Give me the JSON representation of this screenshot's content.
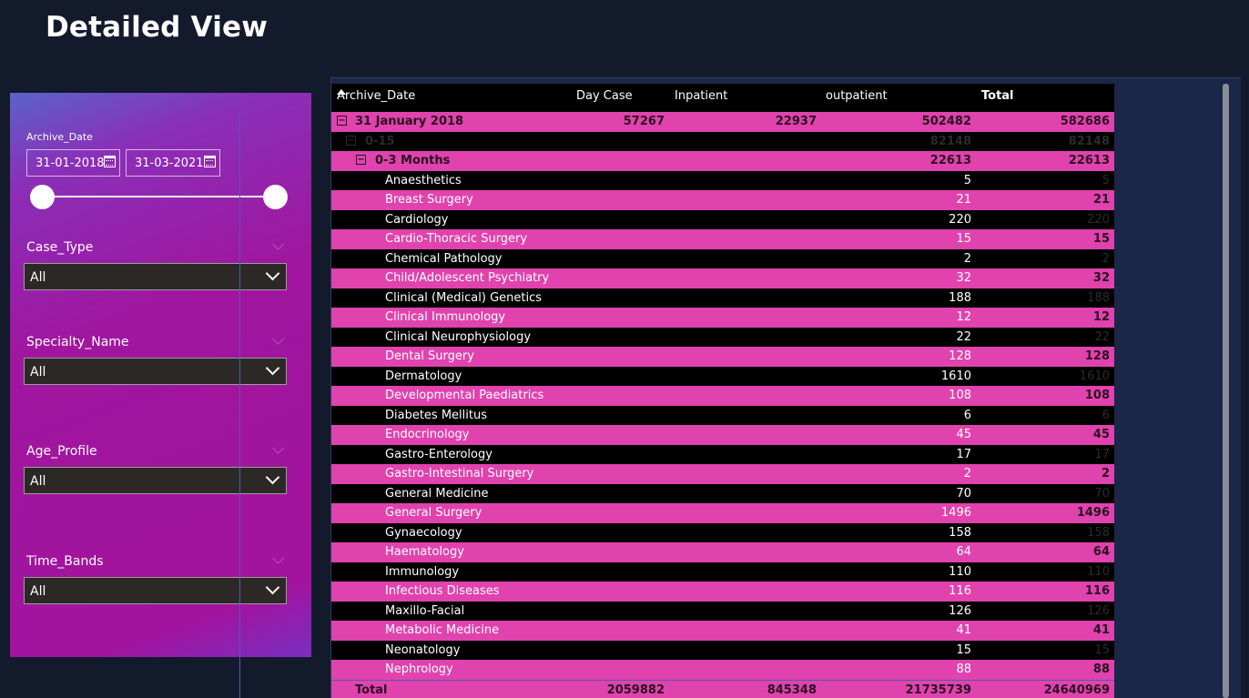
{
  "page": {
    "title": "Detailed View"
  },
  "filters": {
    "archive_date": {
      "label": "Archive_Date",
      "start": "31-01-2018",
      "end": "31-03-2021"
    },
    "case_type": {
      "label": "Case_Type",
      "value": "All"
    },
    "specialty_name": {
      "label": "Specialty_Name",
      "value": "All"
    },
    "age_profile": {
      "label": "Age_Profile",
      "value": "All"
    },
    "time_bands": {
      "label": "Time_Bands",
      "value": "All"
    }
  },
  "matrix": {
    "headers": {
      "row": "Archive_Date",
      "day_case": "Day Case",
      "inpatient": "Inpatient",
      "outpatient": "outpatient",
      "total": "Total"
    },
    "date_row": {
      "label": "31 January 2018",
      "day_case": "57267",
      "inpatient": "22937",
      "outpatient": "502482",
      "total": "582686"
    },
    "age_row": {
      "label": "0-15",
      "outpatient": "82148",
      "total": "82148"
    },
    "band_row": {
      "label": "0-3 Months",
      "outpatient": "22613",
      "total": "22613"
    },
    "rows": [
      {
        "name": "Anaesthetics",
        "outpatient": "5",
        "total": "5"
      },
      {
        "name": "Breast Surgery",
        "outpatient": "21",
        "total": "21"
      },
      {
        "name": "Cardiology",
        "outpatient": "220",
        "total": "220"
      },
      {
        "name": "Cardio-Thoracic Surgery",
        "outpatient": "15",
        "total": "15"
      },
      {
        "name": "Chemical Pathology",
        "outpatient": "2",
        "total": "2"
      },
      {
        "name": "Child/Adolescent Psychiatry",
        "outpatient": "32",
        "total": "32"
      },
      {
        "name": "Clinical (Medical) Genetics",
        "outpatient": "188",
        "total": "188"
      },
      {
        "name": "Clinical Immunology",
        "outpatient": "12",
        "total": "12"
      },
      {
        "name": "Clinical Neurophysiology",
        "outpatient": "22",
        "total": "22"
      },
      {
        "name": "Dental Surgery",
        "outpatient": "128",
        "total": "128"
      },
      {
        "name": "Dermatology",
        "outpatient": "1610",
        "total": "1610"
      },
      {
        "name": "Developmental Paediatrics",
        "outpatient": "108",
        "total": "108"
      },
      {
        "name": "Diabetes Mellitus",
        "outpatient": "6",
        "total": "6"
      },
      {
        "name": "Endocrinology",
        "outpatient": "45",
        "total": "45"
      },
      {
        "name": "Gastro-Enterology",
        "outpatient": "17",
        "total": "17"
      },
      {
        "name": "Gastro-Intestinal Surgery",
        "outpatient": "2",
        "total": "2"
      },
      {
        "name": "General Medicine",
        "outpatient": "70",
        "total": "70"
      },
      {
        "name": "General Surgery",
        "outpatient": "1496",
        "total": "1496"
      },
      {
        "name": "Gynaecology",
        "outpatient": "158",
        "total": "158"
      },
      {
        "name": "Haematology",
        "outpatient": "64",
        "total": "64"
      },
      {
        "name": "Immunology",
        "outpatient": "110",
        "total": "110"
      },
      {
        "name": "Infectious Diseases",
        "outpatient": "116",
        "total": "116"
      },
      {
        "name": "Maxillo-Facial",
        "outpatient": "126",
        "total": "126"
      },
      {
        "name": "Metabolic Medicine",
        "outpatient": "41",
        "total": "41"
      },
      {
        "name": "Neonatology",
        "outpatient": "15",
        "total": "15"
      },
      {
        "name": "Nephrology",
        "outpatient": "88",
        "total": "88"
      }
    ],
    "total_row": {
      "label": "Total",
      "day_case": "2059882",
      "inpatient": "845348",
      "outpatient": "21735739",
      "total": "24640969"
    }
  },
  "colors": {
    "background": "#121a2b",
    "row_pink": "#e043ad",
    "row_dark": "#000000",
    "panel": "#a2139e"
  }
}
